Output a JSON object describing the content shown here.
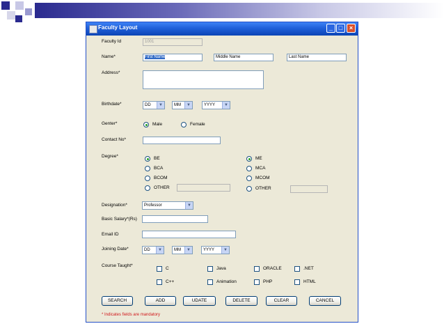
{
  "window": {
    "title": "Faculty Layout"
  },
  "fields": {
    "faculty_id": {
      "label": "Faculty Id",
      "value": "1001"
    },
    "name": {
      "label": "Name*",
      "first": "First Name",
      "middle": "Middle Name",
      "last": "Last Name"
    },
    "address": {
      "label": "Address*"
    },
    "birthdate": {
      "label": "Birthdate*",
      "day": "DD",
      "month": "MM",
      "year": "YYYY"
    },
    "gender": {
      "label": "Genter*",
      "male": "Male",
      "female": "Female"
    },
    "contact": {
      "label": "Contact No*"
    },
    "degree": {
      "label": "Degree*",
      "be": "BE",
      "bca": "BCA",
      "bcom": "BCOM",
      "other1": "OTHER",
      "me": "ME",
      "mca": "MCA",
      "mcom": "MCOM",
      "other2": "OTHER"
    },
    "designation": {
      "label": "Designation*",
      "value": "Professor"
    },
    "salary": {
      "label": "Basic Salary*(Rs)"
    },
    "email": {
      "label": "Email ID"
    },
    "joining": {
      "label": "Joining Date*",
      "day": "DD",
      "month": "MM",
      "year": "YYYY"
    },
    "courses": {
      "label": "Course Taught*",
      "c": "C",
      "java": "Java",
      "oracle": "ORACLE",
      "net": ".NET",
      "cpp": "C++",
      "animation": "Animation",
      "php": "PHP",
      "html": "HTML"
    }
  },
  "buttons": {
    "search": "SEARCH",
    "add": "ADD",
    "update": "UDATE",
    "delete": "DELETE",
    "clear": "CLEAR",
    "cancel": "CANCEL"
  },
  "note": "* Indicates fields are mandatory",
  "colors": {
    "title_bar": "#0b44b5",
    "form_bg": "#ece9d8",
    "note": "#d0181b",
    "deco_bar": "#2a2a8f"
  }
}
